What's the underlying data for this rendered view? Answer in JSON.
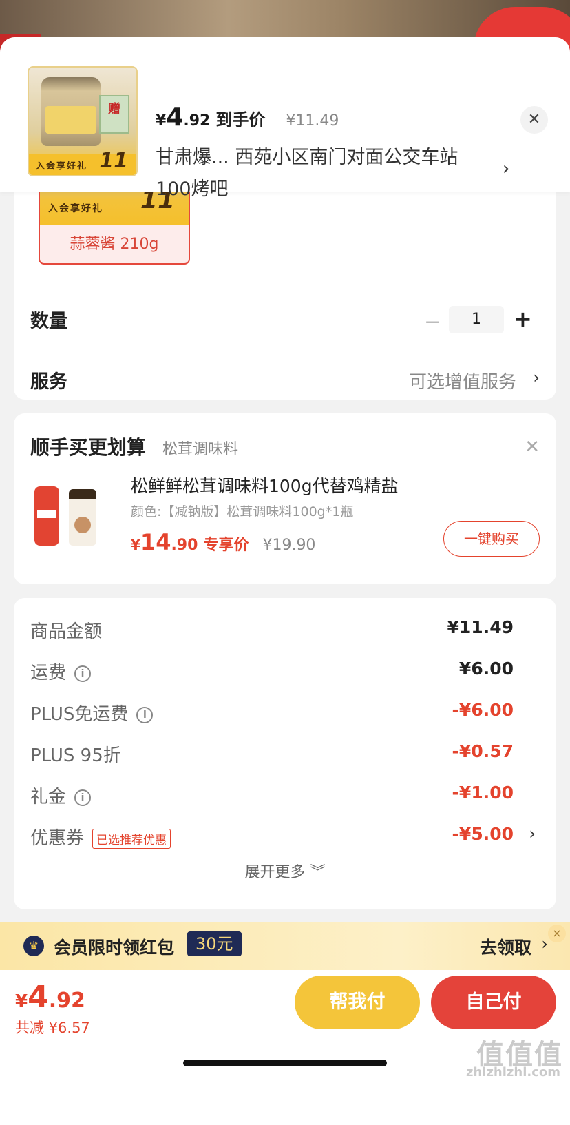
{
  "header": {
    "price_yen": "¥",
    "price_int": "4",
    "price_dec": ".92",
    "price_tag": "到手价",
    "original_price": "¥11.49",
    "address": "甘肃爆... 西苑小区南门对面公交车站100烤吧",
    "close_icon": "close-icon",
    "thumb_band_text": "入会享好礼",
    "thumb_band_num": "11",
    "thumb_side_text": "赠"
  },
  "options": {
    "selected": {
      "label": "蒜蓉酱 210g",
      "band_text": "入会享好礼",
      "band_num": "11"
    }
  },
  "quantity": {
    "label": "数量",
    "value": "1",
    "minus": "−",
    "plus": "+"
  },
  "service": {
    "label": "服务",
    "value": "可选增值服务",
    "chevron": "›"
  },
  "addon": {
    "title": "顺手买更划算",
    "subtitle": "松茸调味料",
    "product_name": "松鲜鲜松茸调味料100g代替鸡精盐",
    "spec": "颜色:【减钠版】松茸调味料100g*1瓶",
    "price_yen": "¥",
    "price_int": "14",
    "price_dec": ".90",
    "price_tag": "专享价",
    "original_price": "¥19.90",
    "buy_label": "一键购买"
  },
  "fees": [
    {
      "label": "商品金额",
      "value": "¥11.49",
      "info": false,
      "red": false
    },
    {
      "label": "运费",
      "value": "¥6.00",
      "info": true,
      "red": false
    },
    {
      "label": "PLUS免运费",
      "value": "-¥6.00",
      "info": true,
      "red": true
    },
    {
      "label": "PLUS 95折",
      "value": "-¥0.57",
      "info": false,
      "red": true
    },
    {
      "label": "礼金",
      "value": "-¥1.00",
      "info": true,
      "red": true
    },
    {
      "label": "优惠券",
      "value": "-¥5.00",
      "badge": "已选推荐优惠",
      "red": true,
      "chevron": "›"
    }
  ],
  "expand_label": "展开更多 ︾",
  "promo": {
    "text": "会员限时领红包",
    "amount": "30元",
    "action": "去领取",
    "chevron": "›",
    "close": "×"
  },
  "footer": {
    "total_yen": "¥",
    "total_int": "4",
    "total_dec": ".92",
    "saved": "共减 ¥6.57",
    "help_pay": "帮我付",
    "self_pay": "自己付"
  },
  "watermark": {
    "logo": "值值值",
    "url": "zhizhizhi.com"
  },
  "colors": {
    "accent_red": "#e4432d",
    "help_yellow": "#f4c53a",
    "promo_navy": "#1f2a55"
  }
}
